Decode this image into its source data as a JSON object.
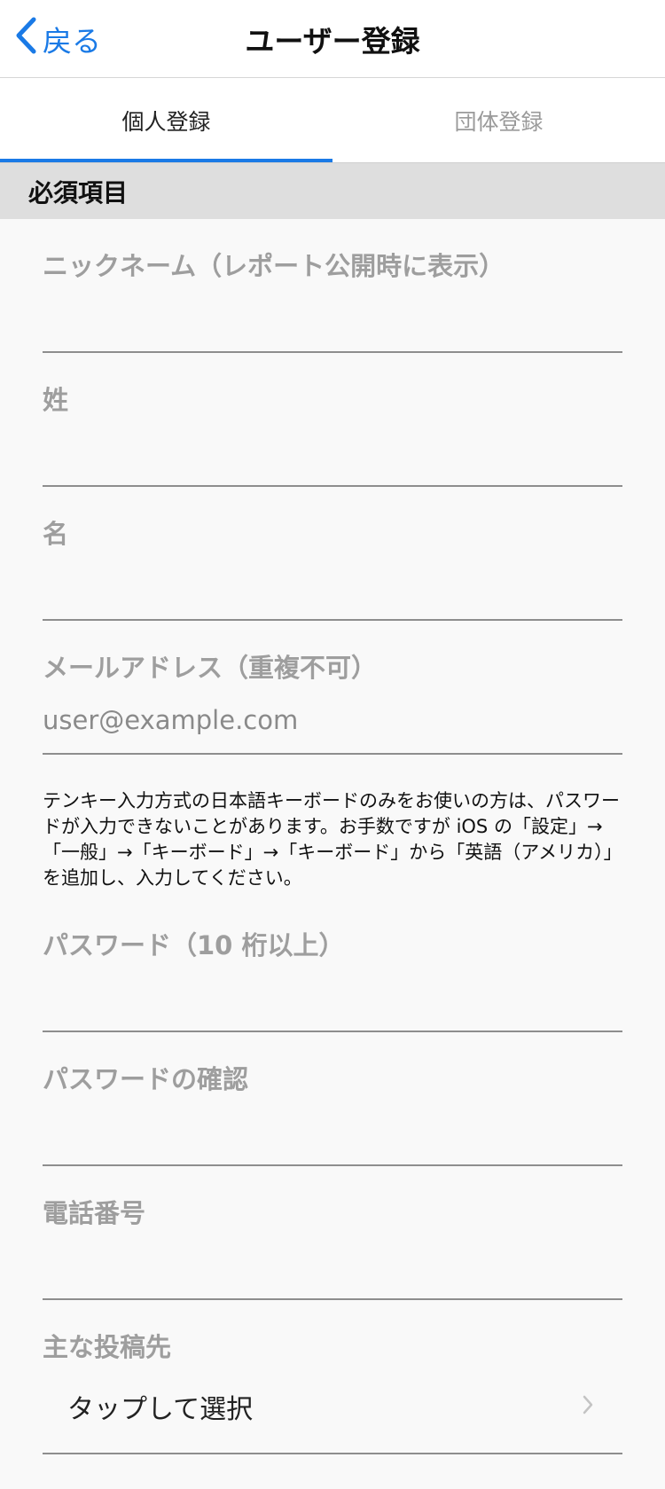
{
  "navbar": {
    "back_label": "戻る",
    "title": "ユーザー登録"
  },
  "tabs": [
    {
      "label": "個人登録",
      "active": true
    },
    {
      "label": "団体登録",
      "active": false
    }
  ],
  "section": {
    "title": "必須項目"
  },
  "fields": {
    "nickname": {
      "label": "ニックネーム（レポート公開時に表示）",
      "placeholder": "",
      "value": ""
    },
    "last_name": {
      "label": "姓",
      "placeholder": "",
      "value": ""
    },
    "first_name": {
      "label": "名",
      "placeholder": "",
      "value": ""
    },
    "email": {
      "label": "メールアドレス（重複不可）",
      "placeholder": "user@example.com",
      "value": ""
    },
    "password": {
      "label": "パスワード（10 桁以上）",
      "placeholder": "",
      "value": ""
    },
    "password_confirm": {
      "label": "パスワードの確認",
      "placeholder": "",
      "value": ""
    },
    "phone": {
      "label": "電話番号",
      "placeholder": "",
      "value": ""
    }
  },
  "keyboard_note": "テンキー入力方式の日本語キーボードのみをお使いの方は、パスワードが入力できないことがあります。お手数ですが iOS の「設定」→「一般」→「キーボード」→「キーボード」から「英語（アメリカ）」を追加し、入力してください。",
  "post_destination": {
    "label": "主な投稿先",
    "value": "タップして選択"
  },
  "colors": {
    "accent": "#1a7ae6",
    "section_bg": "#dedede",
    "label_gray": "#9e9e9e"
  },
  "icons": {
    "back": "chevron-left-icon",
    "select": "chevron-right-icon"
  }
}
